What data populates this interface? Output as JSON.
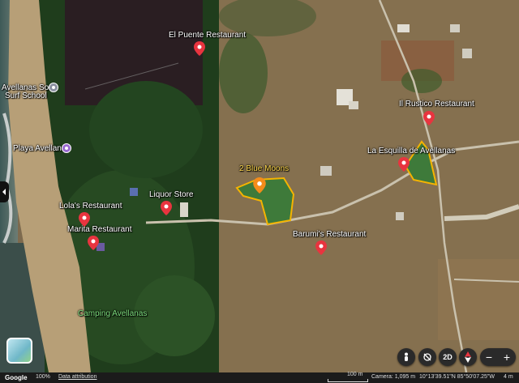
{
  "map": {
    "labels": [
      {
        "id": "el-puente",
        "text": "El Puente Restaurant",
        "style": "white"
      },
      {
        "id": "avellanas-soul",
        "text": "Avellanas Soul",
        "style": "white"
      },
      {
        "id": "surf-school",
        "text": "Surf School",
        "style": "white"
      },
      {
        "id": "il-rustico",
        "text": "Il Rustico Restaurant",
        "style": "white"
      },
      {
        "id": "playa-avellana",
        "text": "Playa Avellana",
        "style": "white"
      },
      {
        "id": "esquilla",
        "text": "La Esquilla de Avellanas",
        "style": "white"
      },
      {
        "id": "blue-moons",
        "text": "2 Blue Moons",
        "style": "yellow"
      },
      {
        "id": "liquor-store",
        "text": "Liquor Store",
        "style": "white"
      },
      {
        "id": "lolas",
        "text": "Lola's Restaurant",
        "style": "white"
      },
      {
        "id": "marita",
        "text": "Marita Restaurant",
        "style": "white"
      },
      {
        "id": "barumis",
        "text": "Barumi's Restaurant",
        "style": "white"
      },
      {
        "id": "camping",
        "text": "Camping Avellanas",
        "style": "green"
      }
    ],
    "pin_color": "#e8343f",
    "selected_pin_color": "#f48c1a",
    "highlight_color": "#f5b400"
  },
  "controls": {
    "layers_icon": "layers-icon",
    "street_view_icon": "pegman-icon",
    "rotate_icon": "rotate-icon",
    "mode_label": "2D",
    "compass_icon": "compass-icon",
    "zoom_out_label": "−",
    "zoom_in_label": "+"
  },
  "footer": {
    "brand": "Google",
    "zoom_level": "100%",
    "data_attribution": "Data attribution",
    "scale_label": "100 m",
    "camera": "Camera: 1,095 m",
    "coordinates": "10°13'39.51\"N 85°50'07.25\"W",
    "elevation": "4 m"
  }
}
